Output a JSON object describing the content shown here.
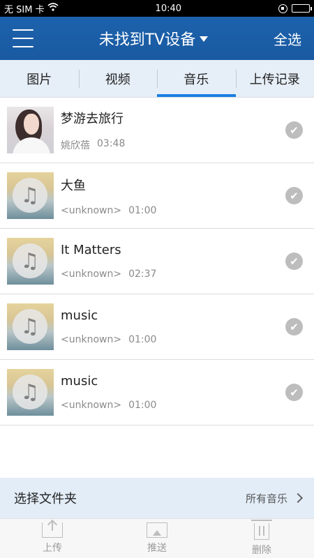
{
  "status": {
    "carrier": "无 SIM 卡",
    "time": "10:40"
  },
  "header": {
    "title": "未找到TV设备",
    "select_all": "全选"
  },
  "tabs": [
    {
      "label": "图片"
    },
    {
      "label": "视频"
    },
    {
      "label": "音乐"
    },
    {
      "label": "上传记录"
    }
  ],
  "songs": [
    {
      "title": "梦游去旅行",
      "artist": "姚欣蓓",
      "duration": "03:48"
    },
    {
      "title": "大鱼",
      "artist": "<unknown>",
      "duration": "01:00"
    },
    {
      "title": "It Matters",
      "artist": "<unknown>",
      "duration": "02:37"
    },
    {
      "title": "music",
      "artist": "<unknown>",
      "duration": "01:00"
    },
    {
      "title": "music",
      "artist": "<unknown>",
      "duration": "01:00"
    }
  ],
  "folder": {
    "title": "选择文件夹",
    "current": "所有音乐"
  },
  "toolbar": {
    "upload": "上传",
    "push": "推送",
    "delete": "删除"
  },
  "icons": {
    "music_note": "♫",
    "check": "✔"
  },
  "colors": {
    "header": "#1b5ea7",
    "accent": "#1b7fe2"
  }
}
